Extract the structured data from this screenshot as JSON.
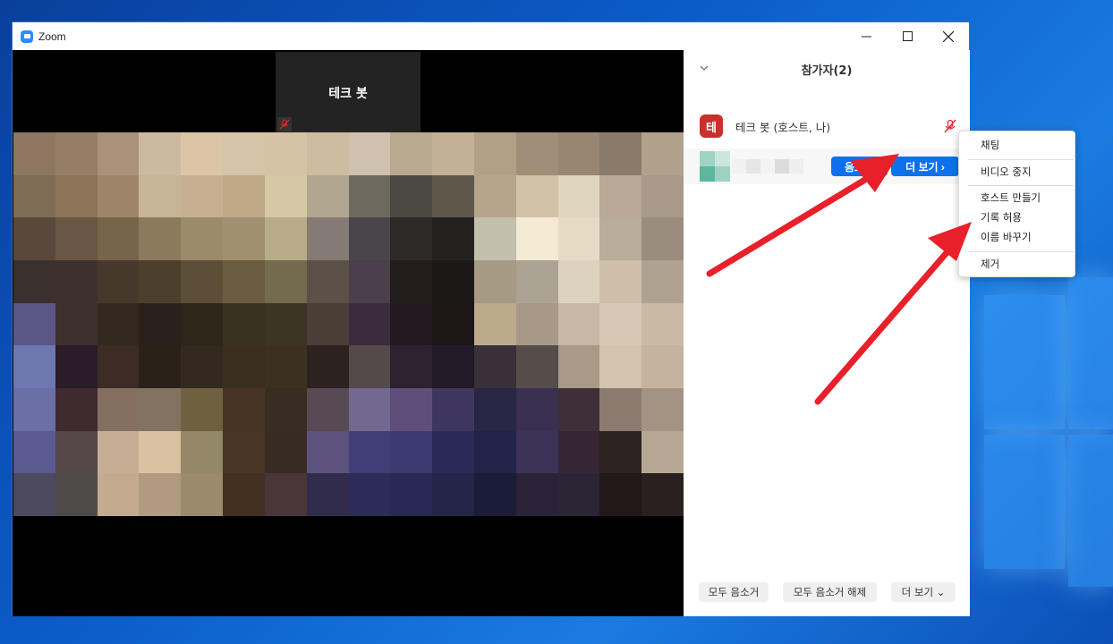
{
  "window": {
    "title": "Zoom",
    "minimize_glyph": "—",
    "maximize_glyph": "☐",
    "close_glyph": "✕"
  },
  "video": {
    "thumbnail_name": "테크 봇",
    "thumbnail_mic_state": "muted"
  },
  "panel": {
    "title": "참가자(2)",
    "collapse_glyph": "⌄",
    "participants": [
      {
        "avatar_letter": "테",
        "avatar_color": "#c9302c",
        "name": "테크 봇 (호스트, 나)",
        "mic": "muted"
      }
    ],
    "row_actions": {
      "mute_label": "음소거",
      "more_label": "더 보기 ›"
    },
    "footer": {
      "mute_all_label": "모두 음소거",
      "unmute_all_label": "모두 음소거 해제",
      "more_label": "더 보기 ⌄"
    }
  },
  "more_menu": {
    "items": [
      "채팅",
      "비디오 중지",
      "호스트 만들기",
      "기록 허용",
      "이름 바꾸기",
      "제거"
    ]
  },
  "colors": {
    "accent": "#0e71eb",
    "annotation_arrow": "#e8202a",
    "desktop": "#0b5cc9"
  }
}
